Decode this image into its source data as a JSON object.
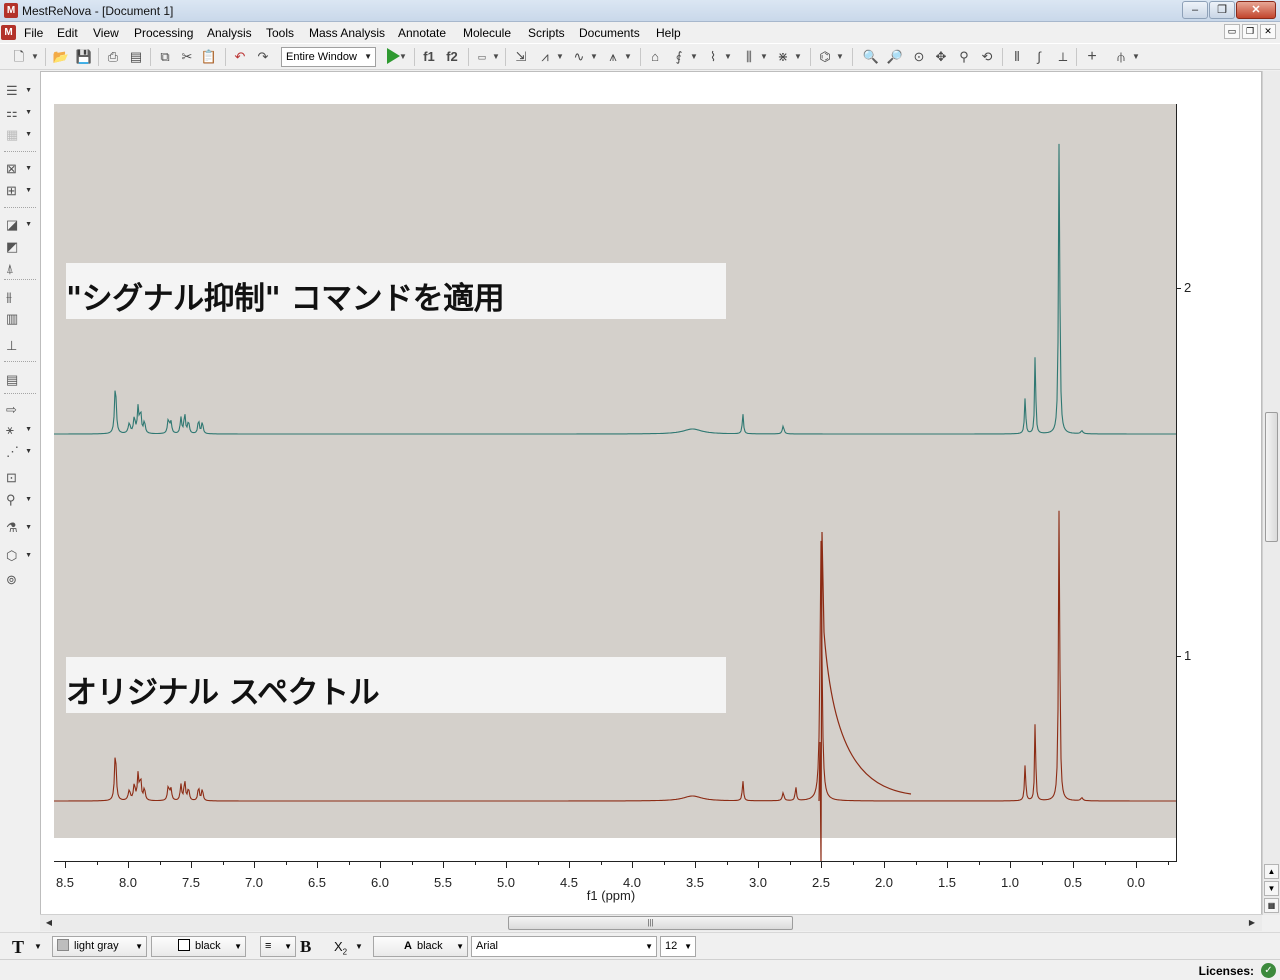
{
  "window": {
    "title": "MestReNova - [Document 1]",
    "buttons": [
      "‒",
      "❐",
      "✕"
    ],
    "mdi_buttons": [
      "▭",
      "❐",
      "✕"
    ]
  },
  "menu": {
    "items": [
      "File",
      "Edit",
      "View",
      "Processing",
      "Analysis",
      "Tools",
      "Mass Analysis",
      "Annotate",
      "Molecule",
      "Scripts",
      "Documents",
      "Help"
    ]
  },
  "toolbar": {
    "zoom_mode": "Entire Window",
    "f1_label": "f1",
    "f2_label": "f2"
  },
  "document": {
    "labels": {
      "top": "\"シグナル抑制\" コマンドを適用",
      "bottom": "オリジナル スペクトル"
    },
    "spectrum_colors": {
      "top": "#2f7872",
      "bottom": "#8c2b14"
    },
    "y_axis": {
      "ticks": [
        "2",
        "1"
      ]
    },
    "x_axis": {
      "title": "f1 (ppm)",
      "ticks": [
        "8.5",
        "8.0",
        "7.5",
        "7.0",
        "6.5",
        "6.0",
        "5.5",
        "5.0",
        "4.5",
        "4.0",
        "3.5",
        "3.0",
        "2.5",
        "2.0",
        "1.5",
        "1.0",
        "0.5",
        "0.0"
      ]
    }
  },
  "format_bar": {
    "fill_color": "light gray",
    "line_color": "black",
    "font_color": "black",
    "font_name": "Arial",
    "font_size": "12"
  },
  "status": {
    "licenses": "Licenses:"
  }
}
